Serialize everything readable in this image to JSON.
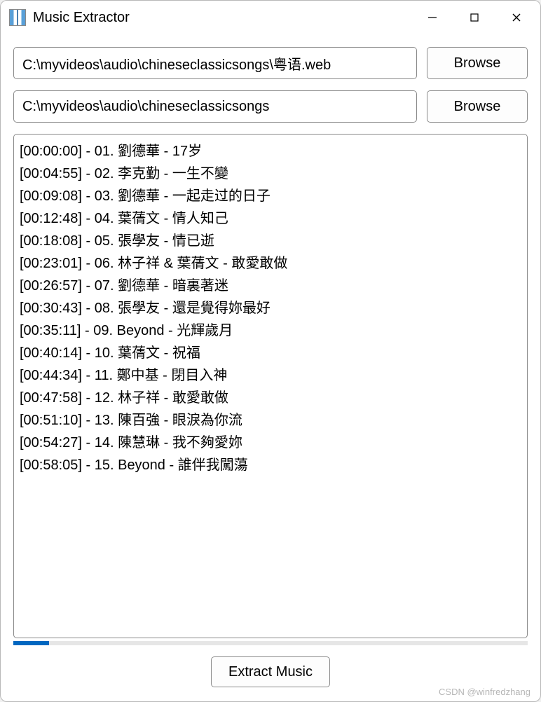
{
  "window": {
    "title": "Music Extractor"
  },
  "inputs": {
    "source_path": "C:\\myvideos\\audio\\chineseclassicsongs\\粤语.web",
    "output_path": "C:\\myvideos\\audio\\chineseclassicsongs",
    "browse_label": "Browse"
  },
  "tracks": [
    "[00:00:00] - 01. 劉德華 - 17岁",
    "[00:04:55] - 02. 李克勤 - 一生不變",
    "[00:09:08] - 03. 劉德華 - 一起走过的日子",
    "[00:12:48] - 04. 葉蒨文 - 情人知己",
    "[00:18:08] - 05. 張學友 - 情已逝",
    "[00:23:01] - 06. 林子祥 & 葉蒨文 - 敢愛敢做",
    "[00:26:57] - 07. 劉德華 - 暗裏著迷",
    "[00:30:43] - 08. 張學友 - 還是覺得妳最好",
    "[00:35:11] - 09. Beyond - 光輝歲月",
    "[00:40:14] - 10. 葉蒨文 - 祝福",
    "[00:44:34] - 11. 鄭中基 - 閉目入神",
    "[00:47:58] - 12. 林子祥 - 敢愛敢做",
    "[00:51:10] - 13. 陳百強 - 眼淚為你流",
    "[00:54:27] - 14. 陳慧琳 - 我不夠愛妳",
    "[00:58:05] - 15. Beyond - 誰伴我闖蕩"
  ],
  "progress": {
    "percent": 7
  },
  "actions": {
    "extract_label": "Extract Music"
  },
  "watermark": "CSDN @winfredzhang"
}
